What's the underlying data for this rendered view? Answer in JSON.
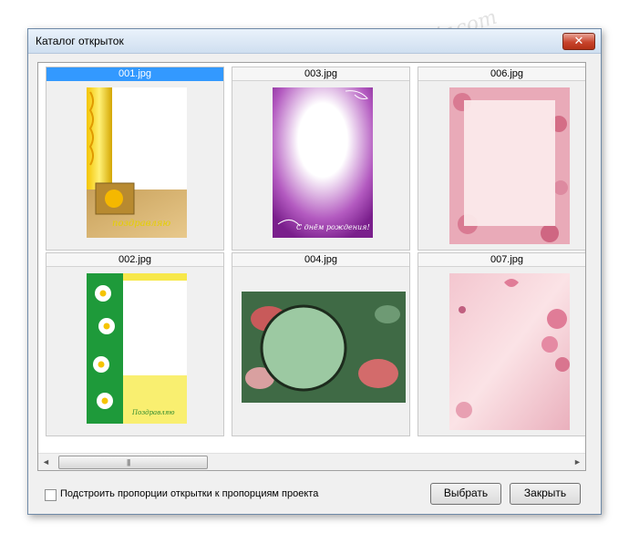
{
  "window": {
    "title": "Каталог открыток",
    "close_symbol": "✕"
  },
  "gallery": {
    "items": [
      {
        "label": "001.jpg"
      },
      {
        "label": "003.jpg"
      },
      {
        "label": "006.jpg"
      },
      {
        "label": "002.jpg"
      },
      {
        "label": "004.jpg"
      },
      {
        "label": "007.jpg"
      }
    ],
    "selected": "001.jpg"
  },
  "thumb_text": {
    "001": "поздравляю",
    "003": "С днём рождения!",
    "002": "Поздравляю"
  },
  "scrollbar": {
    "left_arrow": "◄",
    "right_arrow": "►",
    "grip": "|||"
  },
  "footer": {
    "checkbox_label": "Подстроить пропорции открытки к пропорциям проекта",
    "select_button": "Выбрать",
    "close_button": "Закрыть"
  },
  "watermark": "Soringpcrepair.com",
  "colors": {
    "selection": "#3399ff",
    "close_button": "#c8442c",
    "window_bg": "#f0f0f0"
  }
}
